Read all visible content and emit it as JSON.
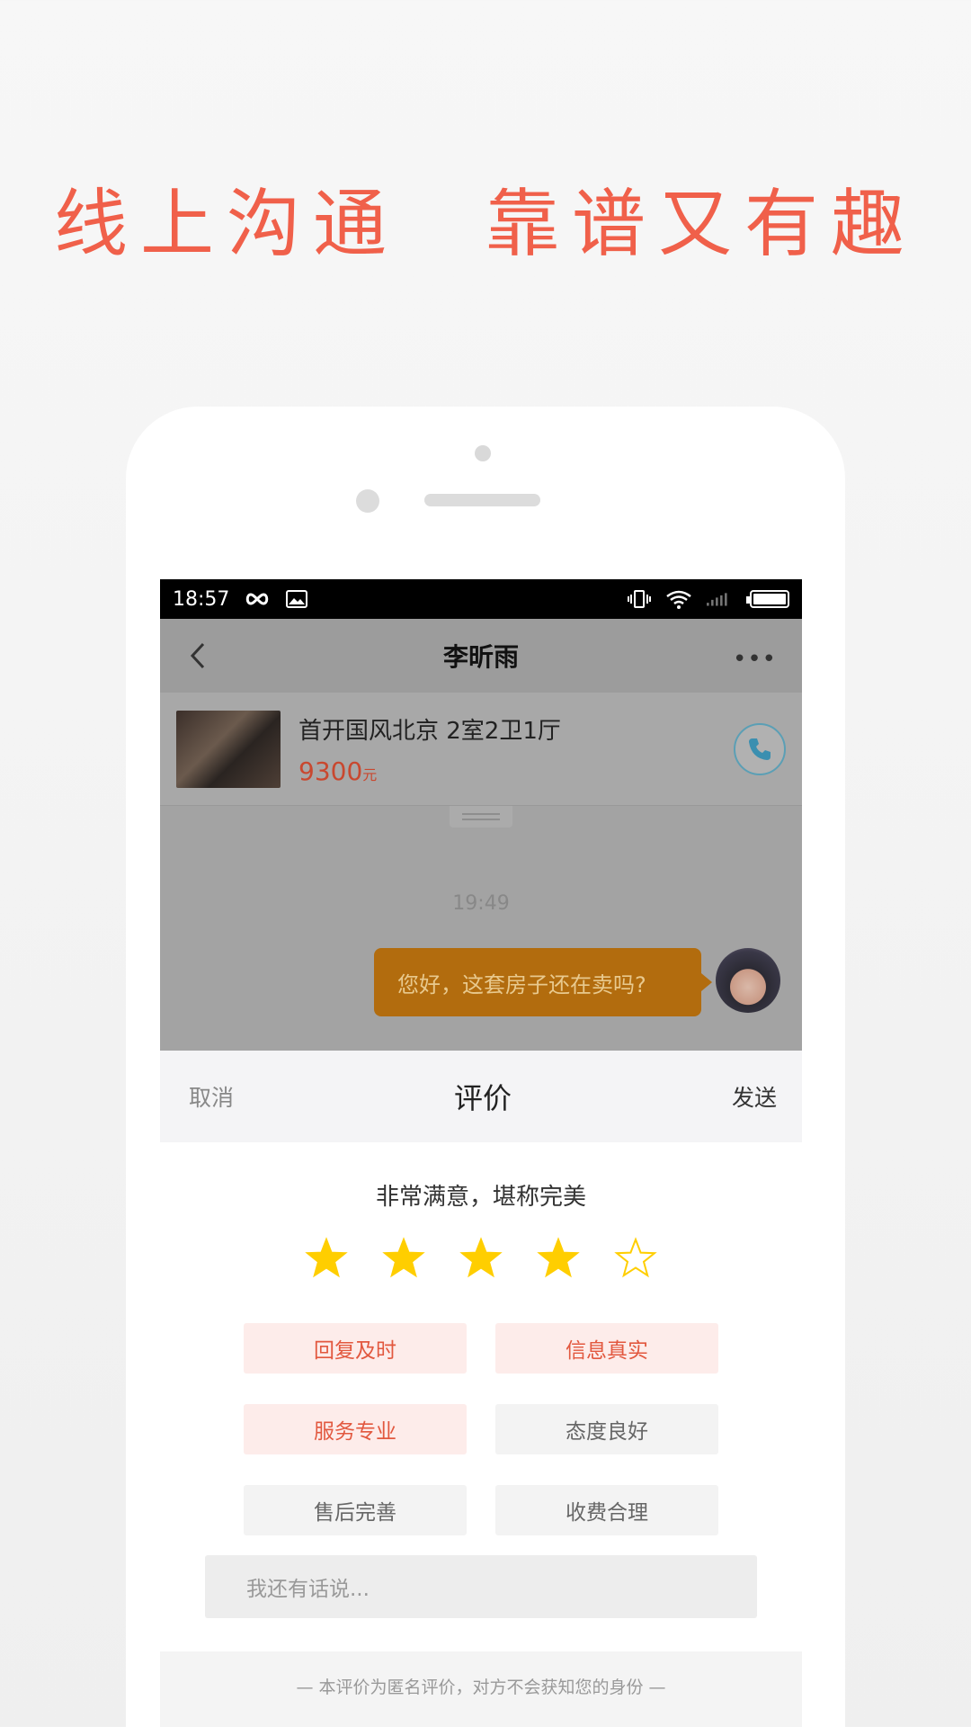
{
  "headline": "线上沟通　靠谱又有趣",
  "status_bar": {
    "time": "18:57"
  },
  "nav": {
    "title": "李昕雨"
  },
  "house": {
    "name": "首开国风北京 2室2卫1厅",
    "price": "9300",
    "unit": "元"
  },
  "chat": {
    "time": "19:49",
    "message": "您好，这套房子还在卖吗?"
  },
  "rating_sheet": {
    "cancel": "取消",
    "title": "评价",
    "send": "发送",
    "rating_text": "非常满意，堪称完美",
    "rating": 4,
    "max_rating": 5,
    "tags": [
      {
        "label": "回复及时",
        "selected": true
      },
      {
        "label": "信息真实",
        "selected": true
      },
      {
        "label": "服务专业",
        "selected": true
      },
      {
        "label": "态度良好",
        "selected": false
      },
      {
        "label": "售后完善",
        "selected": false
      },
      {
        "label": "收费合理",
        "selected": false
      }
    ],
    "comment_placeholder": "我还有话说...",
    "note": "— 本评价为匿名评价，对方不会获知您的身份 —"
  },
  "colors": {
    "accent": "#f0604a",
    "star": "#ffce00",
    "bubble": "#b26c0e"
  }
}
